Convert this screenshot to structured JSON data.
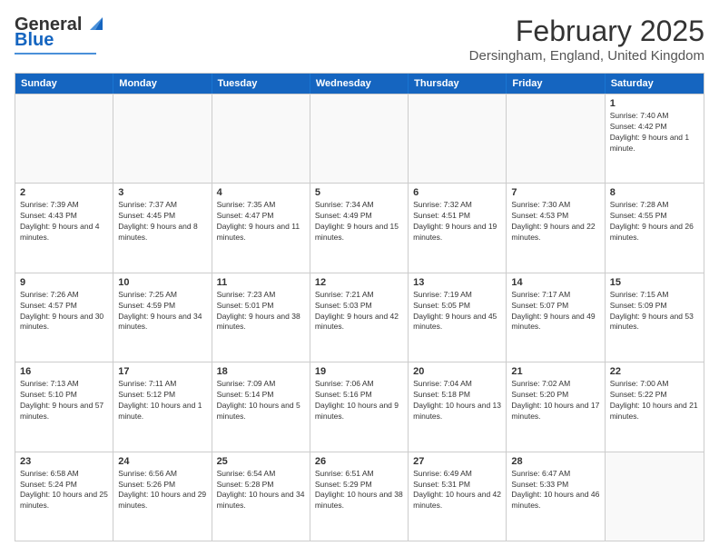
{
  "logo": {
    "general": "General",
    "blue": "Blue"
  },
  "title": "February 2025",
  "location": "Dersingham, England, United Kingdom",
  "days_of_week": [
    "Sunday",
    "Monday",
    "Tuesday",
    "Wednesday",
    "Thursday",
    "Friday",
    "Saturday"
  ],
  "weeks": [
    [
      {
        "day": "",
        "info": ""
      },
      {
        "day": "",
        "info": ""
      },
      {
        "day": "",
        "info": ""
      },
      {
        "day": "",
        "info": ""
      },
      {
        "day": "",
        "info": ""
      },
      {
        "day": "",
        "info": ""
      },
      {
        "day": "1",
        "info": "Sunrise: 7:40 AM\nSunset: 4:42 PM\nDaylight: 9 hours and 1 minute."
      }
    ],
    [
      {
        "day": "2",
        "info": "Sunrise: 7:39 AM\nSunset: 4:43 PM\nDaylight: 9 hours and 4 minutes."
      },
      {
        "day": "3",
        "info": "Sunrise: 7:37 AM\nSunset: 4:45 PM\nDaylight: 9 hours and 8 minutes."
      },
      {
        "day": "4",
        "info": "Sunrise: 7:35 AM\nSunset: 4:47 PM\nDaylight: 9 hours and 11 minutes."
      },
      {
        "day": "5",
        "info": "Sunrise: 7:34 AM\nSunset: 4:49 PM\nDaylight: 9 hours and 15 minutes."
      },
      {
        "day": "6",
        "info": "Sunrise: 7:32 AM\nSunset: 4:51 PM\nDaylight: 9 hours and 19 minutes."
      },
      {
        "day": "7",
        "info": "Sunrise: 7:30 AM\nSunset: 4:53 PM\nDaylight: 9 hours and 22 minutes."
      },
      {
        "day": "8",
        "info": "Sunrise: 7:28 AM\nSunset: 4:55 PM\nDaylight: 9 hours and 26 minutes."
      }
    ],
    [
      {
        "day": "9",
        "info": "Sunrise: 7:26 AM\nSunset: 4:57 PM\nDaylight: 9 hours and 30 minutes."
      },
      {
        "day": "10",
        "info": "Sunrise: 7:25 AM\nSunset: 4:59 PM\nDaylight: 9 hours and 34 minutes."
      },
      {
        "day": "11",
        "info": "Sunrise: 7:23 AM\nSunset: 5:01 PM\nDaylight: 9 hours and 38 minutes."
      },
      {
        "day": "12",
        "info": "Sunrise: 7:21 AM\nSunset: 5:03 PM\nDaylight: 9 hours and 42 minutes."
      },
      {
        "day": "13",
        "info": "Sunrise: 7:19 AM\nSunset: 5:05 PM\nDaylight: 9 hours and 45 minutes."
      },
      {
        "day": "14",
        "info": "Sunrise: 7:17 AM\nSunset: 5:07 PM\nDaylight: 9 hours and 49 minutes."
      },
      {
        "day": "15",
        "info": "Sunrise: 7:15 AM\nSunset: 5:09 PM\nDaylight: 9 hours and 53 minutes."
      }
    ],
    [
      {
        "day": "16",
        "info": "Sunrise: 7:13 AM\nSunset: 5:10 PM\nDaylight: 9 hours and 57 minutes."
      },
      {
        "day": "17",
        "info": "Sunrise: 7:11 AM\nSunset: 5:12 PM\nDaylight: 10 hours and 1 minute."
      },
      {
        "day": "18",
        "info": "Sunrise: 7:09 AM\nSunset: 5:14 PM\nDaylight: 10 hours and 5 minutes."
      },
      {
        "day": "19",
        "info": "Sunrise: 7:06 AM\nSunset: 5:16 PM\nDaylight: 10 hours and 9 minutes."
      },
      {
        "day": "20",
        "info": "Sunrise: 7:04 AM\nSunset: 5:18 PM\nDaylight: 10 hours and 13 minutes."
      },
      {
        "day": "21",
        "info": "Sunrise: 7:02 AM\nSunset: 5:20 PM\nDaylight: 10 hours and 17 minutes."
      },
      {
        "day": "22",
        "info": "Sunrise: 7:00 AM\nSunset: 5:22 PM\nDaylight: 10 hours and 21 minutes."
      }
    ],
    [
      {
        "day": "23",
        "info": "Sunrise: 6:58 AM\nSunset: 5:24 PM\nDaylight: 10 hours and 25 minutes."
      },
      {
        "day": "24",
        "info": "Sunrise: 6:56 AM\nSunset: 5:26 PM\nDaylight: 10 hours and 29 minutes."
      },
      {
        "day": "25",
        "info": "Sunrise: 6:54 AM\nSunset: 5:28 PM\nDaylight: 10 hours and 34 minutes."
      },
      {
        "day": "26",
        "info": "Sunrise: 6:51 AM\nSunset: 5:29 PM\nDaylight: 10 hours and 38 minutes."
      },
      {
        "day": "27",
        "info": "Sunrise: 6:49 AM\nSunset: 5:31 PM\nDaylight: 10 hours and 42 minutes."
      },
      {
        "day": "28",
        "info": "Sunrise: 6:47 AM\nSunset: 5:33 PM\nDaylight: 10 hours and 46 minutes."
      },
      {
        "day": "",
        "info": ""
      }
    ]
  ]
}
